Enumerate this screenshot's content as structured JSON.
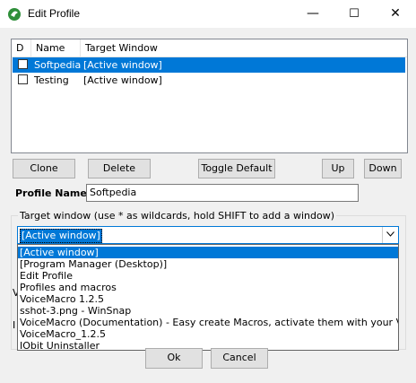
{
  "window": {
    "title": "Edit Profile",
    "minimize": "—",
    "maximize": "☐",
    "close": "✕"
  },
  "profiles": {
    "columns": [
      "D",
      "Name",
      "Target Window"
    ],
    "rows": [
      {
        "checked": false,
        "name": "Softpedia",
        "target": "[Active window]",
        "selected": true
      },
      {
        "checked": false,
        "name": "Testing",
        "target": "[Active window]",
        "selected": false
      }
    ]
  },
  "buttons": {
    "clone": "Clone",
    "delete": "Delete",
    "toggle_default": "Toggle Default",
    "up": "Up",
    "down": "Down",
    "ok": "Ok",
    "cancel": "Cancel"
  },
  "profile_name": {
    "label": "Profile Name",
    "value": "Softpedia"
  },
  "target_window": {
    "group_label": "Target window (use * as wildcards, hold SHIFT to add a window)",
    "selected": "[Active window]",
    "options": [
      "[Active window]",
      "[Program Manager (Desktop)]",
      "Edit Profile",
      "Profiles and macros",
      "VoiceMacro 1.2.5",
      "sshot-3.png - WinSnap",
      "VoiceMacro (Documentation) - Easy create Macros, activate them with your Voice, Mous",
      "VoiceMacro_1.2.5",
      "IObit Uninstaller"
    ],
    "peek_letters": [
      "V",
      "I"
    ]
  },
  "colors": {
    "accent": "#0078d7"
  }
}
